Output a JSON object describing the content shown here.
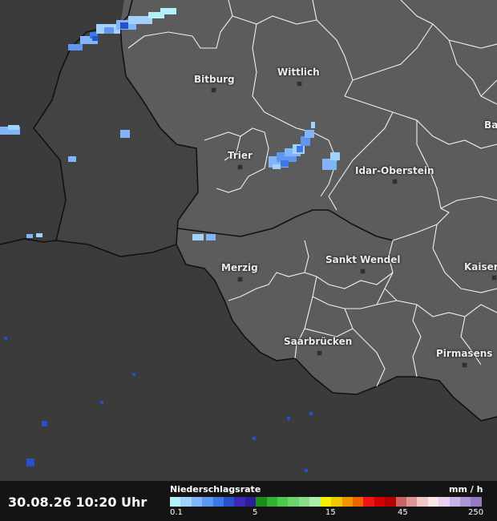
{
  "map": {
    "cities": [
      {
        "name": "Bitburg"
      },
      {
        "name": "Wittlich"
      },
      {
        "name": "Trier"
      },
      {
        "name": "Idar-Oberstein"
      },
      {
        "name": "Merzig"
      },
      {
        "name": "Sankt Wendel"
      },
      {
        "name": "Saarbrücken"
      },
      {
        "name": "Pirmasens"
      },
      {
        "name": "Kaisers"
      },
      {
        "name": "Ba"
      }
    ]
  },
  "footer": {
    "timestamp": "30.08.26 10:20 Uhr",
    "legend": {
      "title": "Niederschlagsrate",
      "unit": "mm / h",
      "ticks": [
        "0.1",
        "5",
        "15",
        "45",
        "250"
      ],
      "colors": [
        "#b4f0fa",
        "#a0d2fa",
        "#82b4fa",
        "#5f96f0",
        "#3c78e6",
        "#2850c8",
        "#3c28b4",
        "#2d1e96",
        "#1e8c1e",
        "#32b432",
        "#50c850",
        "#6ed26e",
        "#8cdc8c",
        "#aaf0aa",
        "#f0f000",
        "#f0c800",
        "#f09600",
        "#f06400",
        "#f01414",
        "#d20000",
        "#b40000",
        "#c86464",
        "#dc9696",
        "#f0c8c8",
        "#fae6e6",
        "#e6d2f0",
        "#c8b4e6",
        "#aa96d2",
        "#967ac8"
      ]
    }
  }
}
